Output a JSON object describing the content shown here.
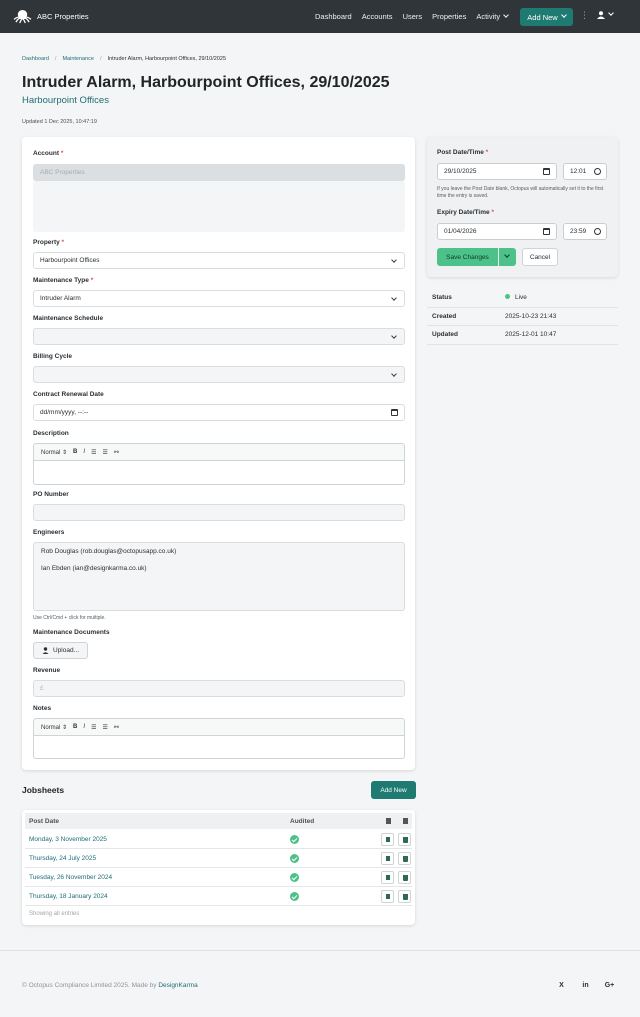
{
  "nav": {
    "brand": "ABC Properties",
    "links": [
      "Dashboard",
      "Accounts",
      "Users",
      "Properties",
      "Activity"
    ],
    "add_new": "Add New"
  },
  "breadcrumb": [
    "Dashboard",
    "Maintenance",
    "Intruder Alarm, Harbourpoint Offices, 29/10/2025"
  ],
  "page": {
    "title": "Intruder Alarm, Harbourpoint Offices, 29/10/2025",
    "subtitle": "Harbourpoint Offices",
    "updated": "Updated 1 Dec 2025, 10:47:19"
  },
  "form": {
    "account_label": "Account",
    "account_value": "ABC Properties",
    "property_label": "Property",
    "property_value": "Harbourpoint Offices",
    "type_label": "Maintenance Type",
    "type_value": "Intruder Alarm",
    "schedule_label": "Maintenance Schedule",
    "billing_label": "Billing Cycle",
    "renewal_label": "Contract Renewal Date",
    "renewal_placeholder": "dd/mm/yyyy, --:--",
    "description_label": "Description",
    "editor_format": "Normal",
    "po_label": "PO Number",
    "engineers_label": "Engineers",
    "engineers": [
      "Rob Douglas (rob.douglas@octopusapp.co.uk)",
      "Ian Ebden (ian@designkarma.co.uk)"
    ],
    "engineers_help": "Use Ctrl/Cmd + click for multiple.",
    "documents_label": "Maintenance Documents",
    "upload_label": "Upload...",
    "revenue_label": "Revenue",
    "revenue_placeholder": "£",
    "notes_label": "Notes",
    "required_mark": "*"
  },
  "post": {
    "post_label": "Post Date/Time",
    "post_date": "29/10/2025",
    "post_time": "12:01",
    "help": "If you leave the Post Date blank, Octopus will automatically set it to the first time the entry is saved.",
    "expiry_label": "Expiry Date/Time",
    "expiry_date": "01/04/2026",
    "expiry_time": "23:59",
    "save_label": "Save Changes",
    "cancel_label": "Cancel"
  },
  "meta": {
    "status_label": "Status",
    "status_value": "Live",
    "created_label": "Created",
    "created_value": "2025-10-23 21:43",
    "updated_label": "Updated",
    "updated_value": "2025-12-01 10:47"
  },
  "jobsheets": {
    "title": "Jobsheets",
    "add_label": "Add New",
    "col_date": "Post Date",
    "col_audited": "Audited",
    "rows": [
      "Monday, 3 November 2025",
      "Thursday, 24 July 2025",
      "Tuesday, 26 November 2024",
      "Thursday, 18 January 2024"
    ],
    "showing": "Showing all entries"
  },
  "footer": {
    "copyright": "© Octopus Compliance Limited 2025. Made by",
    "maker": "DesignKarma",
    "social": [
      "X",
      "in",
      "G+"
    ]
  },
  "colors": {
    "nav_bg": "#2f3539",
    "accent": "#1f7a71",
    "success": "#4cc28a",
    "link": "#1f6d74"
  }
}
